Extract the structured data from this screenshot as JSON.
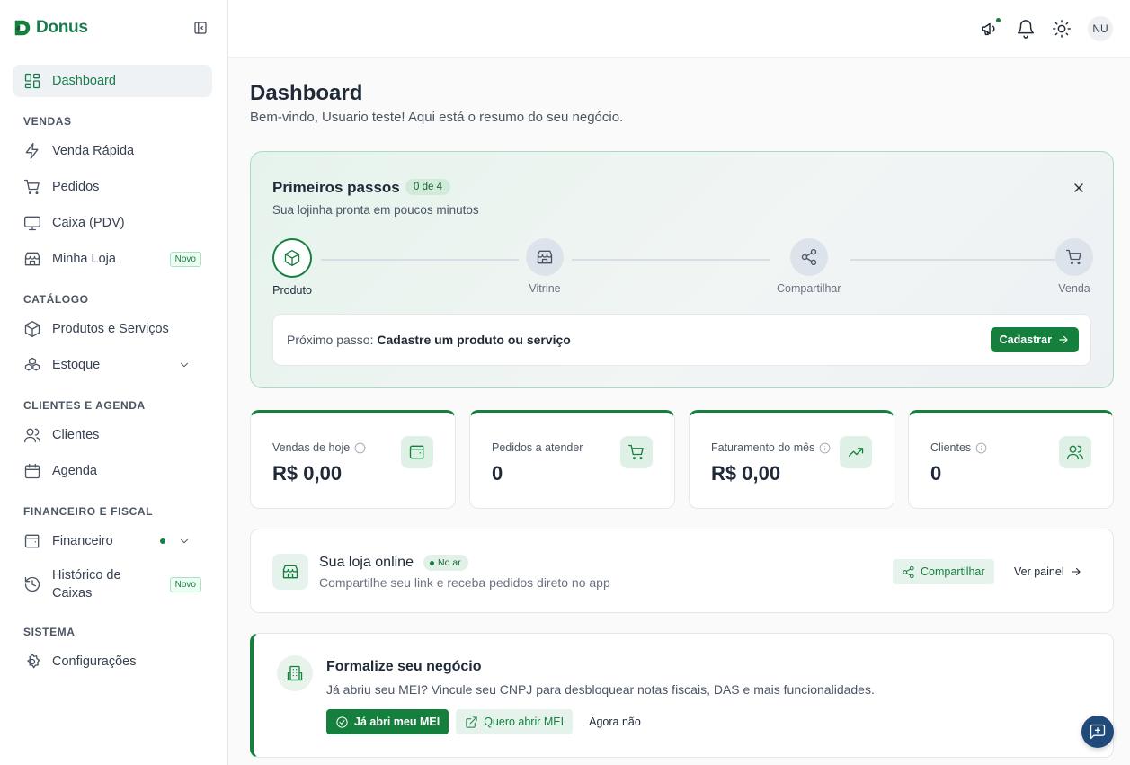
{
  "app": {
    "name": "Donus",
    "brand_color": "#15803d"
  },
  "sidebar": {
    "dashboard": "Dashboard",
    "sections": {
      "vendas": "VENDAS",
      "catalogo": "CATÁLOGO",
      "clientes": "CLIENTES E AGENDA",
      "financeiro": "FINANCEIRO E FISCAL",
      "sistema": "SISTEMA"
    },
    "items": {
      "venda_rapida": "Venda Rápida",
      "pedidos": "Pedidos",
      "caixa": "Caixa (PDV)",
      "minha_loja": "Minha Loja",
      "produtos": "Produtos e Serviços",
      "estoque": "Estoque",
      "clientes": "Clientes",
      "agenda": "Agenda",
      "financeiro": "Financeiro",
      "historico_1": "Histórico de",
      "historico_2": "Caixas",
      "configuracoes": "Configurações"
    },
    "badge_novo": "Novo"
  },
  "topbar": {
    "avatar": "NU"
  },
  "page": {
    "title": "Dashboard",
    "subtitle": "Bem-vindo, Usuario teste! Aqui está o resumo do seu negócio."
  },
  "onboarding": {
    "title": "Primeiros passos",
    "count": "0 de 4",
    "subtitle": "Sua lojinha pronta em poucos minutos",
    "steps": [
      "Produto",
      "Vitrine",
      "Compartilhar",
      "Venda"
    ],
    "next_prefix": "Próximo passo: ",
    "next_action": "Cadastre um produto ou serviço",
    "button": "Cadastrar"
  },
  "stats": [
    {
      "label": "Vendas de hoje",
      "value": "R$ 0,00",
      "icon": "wallet-icon"
    },
    {
      "label": "Pedidos a atender",
      "value": "0",
      "icon": "cart-icon"
    },
    {
      "label": "Faturamento do mês",
      "value": "R$ 0,00",
      "icon": "trend-up-icon"
    },
    {
      "label": "Clientes",
      "value": "0",
      "icon": "users-icon"
    }
  ],
  "store": {
    "title": "Sua loja online",
    "status": "No ar",
    "subtitle": "Compartilhe seu link e receba pedidos direto no app",
    "share": "Compartilhar",
    "view": "Ver painel"
  },
  "mei": {
    "title": "Formalize seu negócio",
    "subtitle": "Já abriu seu MEI? Vincule seu CNPJ para desbloquear notas fiscais, DAS e mais funcionalidades.",
    "btn_primary": "Já abri meu MEI",
    "btn_secondary": "Quero abrir MEI",
    "btn_dismiss": "Agora não"
  }
}
